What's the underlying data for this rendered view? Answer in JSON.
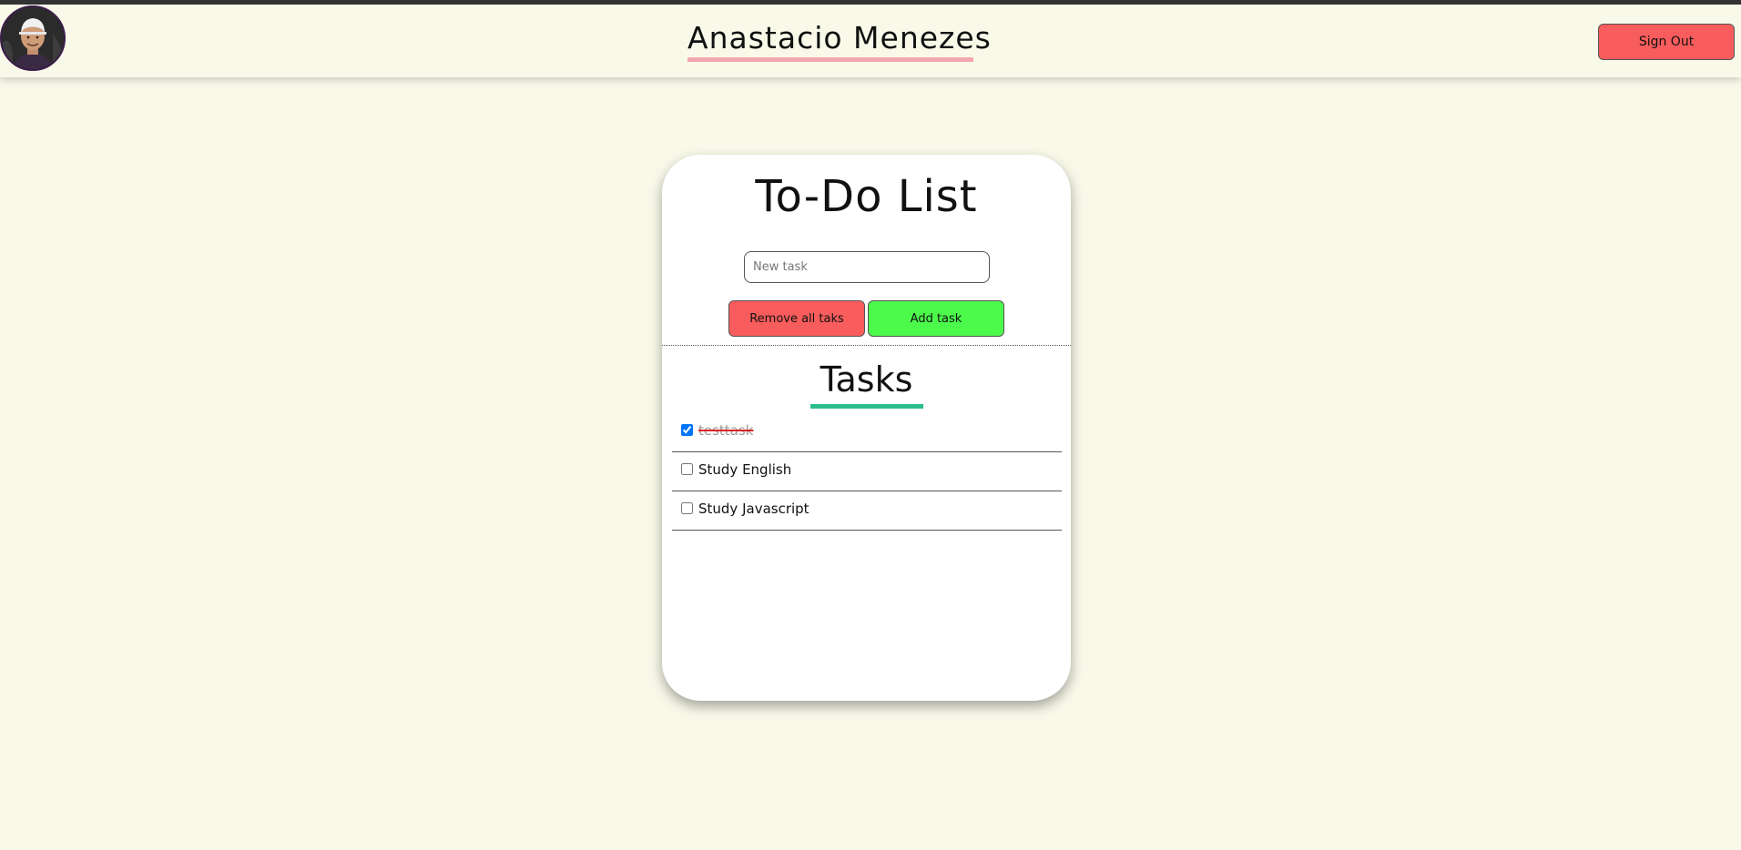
{
  "header": {
    "user_name": "Anastacio Menezes",
    "sign_out_label": "Sign Out",
    "underline_color": "#f4a7ae"
  },
  "todo": {
    "title": "To-Do List",
    "input_placeholder": "New task",
    "input_value": "",
    "remove_all_label": "Remove all taks",
    "add_label": "Add task",
    "tasks_heading": "Tasks",
    "tasks_underline_color": "#2bbd8c"
  },
  "tasks": [
    {
      "label": "testtask",
      "done": true
    },
    {
      "label": "Study English",
      "done": false
    },
    {
      "label": "Study Javascript",
      "done": false
    }
  ],
  "colors": {
    "background": "#f9f9ea",
    "danger": "#f95c5c",
    "success": "#4cfa4c"
  },
  "icons": {
    "avatar": "user-avatar-photo"
  }
}
